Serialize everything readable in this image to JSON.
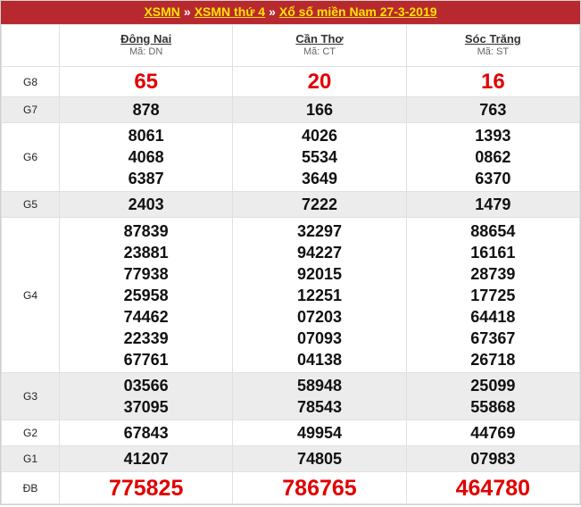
{
  "breadcrumb": {
    "items": [
      "XSMN",
      "XSMN thứ 4",
      "Xổ số miền Nam 27-3-2019"
    ],
    "separator": "»"
  },
  "provinces": [
    {
      "name": "Đông Nai",
      "code": "Mã: DN"
    },
    {
      "name": "Cần Thơ",
      "code": "Mã: CT"
    },
    {
      "name": "Sóc Trăng",
      "code": "Mã: ST"
    }
  ],
  "prizes": [
    {
      "label": "G8",
      "values": [
        [
          "65"
        ],
        [
          "20"
        ],
        [
          "16"
        ]
      ]
    },
    {
      "label": "G7",
      "values": [
        [
          "878"
        ],
        [
          "166"
        ],
        [
          "763"
        ]
      ]
    },
    {
      "label": "G6",
      "values": [
        [
          "8061",
          "4068",
          "6387"
        ],
        [
          "4026",
          "5534",
          "3649"
        ],
        [
          "1393",
          "0862",
          "6370"
        ]
      ]
    },
    {
      "label": "G5",
      "values": [
        [
          "2403"
        ],
        [
          "7222"
        ],
        [
          "1479"
        ]
      ]
    },
    {
      "label": "G4",
      "values": [
        [
          "87839",
          "23881",
          "77938",
          "25958",
          "74462",
          "22339",
          "67761"
        ],
        [
          "32297",
          "94227",
          "92015",
          "12251",
          "07203",
          "07093",
          "04138"
        ],
        [
          "88654",
          "16161",
          "28739",
          "17725",
          "64418",
          "67367",
          "26718"
        ]
      ]
    },
    {
      "label": "G3",
      "values": [
        [
          "03566",
          "37095"
        ],
        [
          "58948",
          "78543"
        ],
        [
          "25099",
          "55868"
        ]
      ]
    },
    {
      "label": "G2",
      "values": [
        [
          "67843"
        ],
        [
          "49954"
        ],
        [
          "44769"
        ]
      ]
    },
    {
      "label": "G1",
      "values": [
        [
          "41207"
        ],
        [
          "74805"
        ],
        [
          "07983"
        ]
      ]
    },
    {
      "label": "ĐB",
      "values": [
        [
          "775825"
        ],
        [
          "786765"
        ],
        [
          "464780"
        ]
      ]
    }
  ],
  "colors": {
    "header_bg": "#b8292f",
    "header_text": "#ffe400",
    "highlight": "#e20000",
    "alt_row": "#ececec"
  }
}
